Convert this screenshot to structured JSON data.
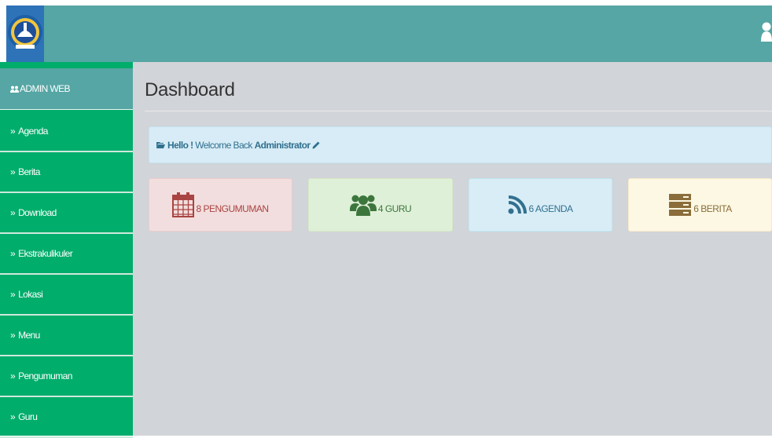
{
  "topbar": {
    "logo_icon": "tut-wuri-handayani-logo",
    "user_icon": "user-icon"
  },
  "sidebar": {
    "header": {
      "icon": "users-icon",
      "label": "ADMIN WEB"
    },
    "raquo": "»",
    "items": [
      {
        "label": "Agenda"
      },
      {
        "label": "Berita"
      },
      {
        "label": "Download"
      },
      {
        "label": "Ekstrakulikuler"
      },
      {
        "label": "Lokasi"
      },
      {
        "label": "Menu"
      },
      {
        "label": "Pengumuman"
      },
      {
        "label": "Guru"
      }
    ]
  },
  "main": {
    "title": "Dashboard",
    "alert": {
      "hello": "Hello",
      "exclaim": " ! ",
      "text": "Welcome Back ",
      "user": "Administrator"
    },
    "tiles": [
      {
        "count": "8",
        "label": "PENGUMUMAN",
        "icon": "calendar-icon",
        "color": "#a94442"
      },
      {
        "count": "4",
        "label": "GURU",
        "icon": "group-icon",
        "color": "#3c763d"
      },
      {
        "count": "6",
        "label": "AGENDA",
        "icon": "rss-icon",
        "color": "#31708f"
      },
      {
        "count": "6",
        "label": "BERITA",
        "icon": "server-icon",
        "color": "#8a6d3b"
      }
    ]
  }
}
